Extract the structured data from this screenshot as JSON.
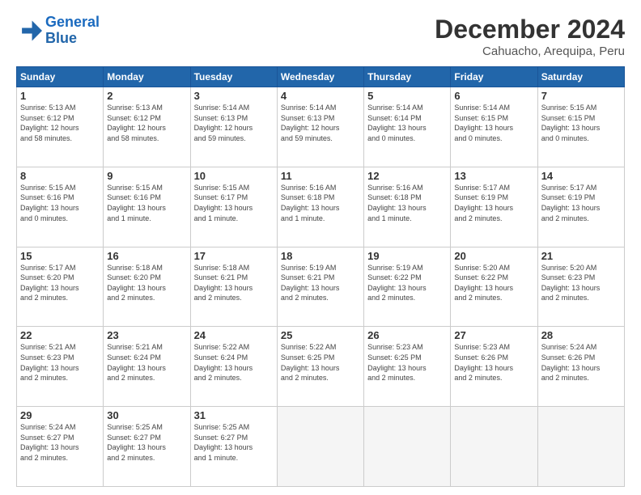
{
  "header": {
    "logo_line1": "General",
    "logo_line2": "Blue",
    "month": "December 2024",
    "location": "Cahuacho, Arequipa, Peru"
  },
  "days_of_week": [
    "Sunday",
    "Monday",
    "Tuesday",
    "Wednesday",
    "Thursday",
    "Friday",
    "Saturday"
  ],
  "weeks": [
    [
      {
        "day": "1",
        "info": "Sunrise: 5:13 AM\nSunset: 6:12 PM\nDaylight: 12 hours\nand 58 minutes."
      },
      {
        "day": "2",
        "info": "Sunrise: 5:13 AM\nSunset: 6:12 PM\nDaylight: 12 hours\nand 58 minutes."
      },
      {
        "day": "3",
        "info": "Sunrise: 5:14 AM\nSunset: 6:13 PM\nDaylight: 12 hours\nand 59 minutes."
      },
      {
        "day": "4",
        "info": "Sunrise: 5:14 AM\nSunset: 6:13 PM\nDaylight: 12 hours\nand 59 minutes."
      },
      {
        "day": "5",
        "info": "Sunrise: 5:14 AM\nSunset: 6:14 PM\nDaylight: 13 hours\nand 0 minutes."
      },
      {
        "day": "6",
        "info": "Sunrise: 5:14 AM\nSunset: 6:15 PM\nDaylight: 13 hours\nand 0 minutes."
      },
      {
        "day": "7",
        "info": "Sunrise: 5:15 AM\nSunset: 6:15 PM\nDaylight: 13 hours\nand 0 minutes."
      }
    ],
    [
      {
        "day": "8",
        "info": "Sunrise: 5:15 AM\nSunset: 6:16 PM\nDaylight: 13 hours\nand 0 minutes."
      },
      {
        "day": "9",
        "info": "Sunrise: 5:15 AM\nSunset: 6:16 PM\nDaylight: 13 hours\nand 1 minute."
      },
      {
        "day": "10",
        "info": "Sunrise: 5:15 AM\nSunset: 6:17 PM\nDaylight: 13 hours\nand 1 minute."
      },
      {
        "day": "11",
        "info": "Sunrise: 5:16 AM\nSunset: 6:18 PM\nDaylight: 13 hours\nand 1 minute."
      },
      {
        "day": "12",
        "info": "Sunrise: 5:16 AM\nSunset: 6:18 PM\nDaylight: 13 hours\nand 1 minute."
      },
      {
        "day": "13",
        "info": "Sunrise: 5:17 AM\nSunset: 6:19 PM\nDaylight: 13 hours\nand 2 minutes."
      },
      {
        "day": "14",
        "info": "Sunrise: 5:17 AM\nSunset: 6:19 PM\nDaylight: 13 hours\nand 2 minutes."
      }
    ],
    [
      {
        "day": "15",
        "info": "Sunrise: 5:17 AM\nSunset: 6:20 PM\nDaylight: 13 hours\nand 2 minutes."
      },
      {
        "day": "16",
        "info": "Sunrise: 5:18 AM\nSunset: 6:20 PM\nDaylight: 13 hours\nand 2 minutes."
      },
      {
        "day": "17",
        "info": "Sunrise: 5:18 AM\nSunset: 6:21 PM\nDaylight: 13 hours\nand 2 minutes."
      },
      {
        "day": "18",
        "info": "Sunrise: 5:19 AM\nSunset: 6:21 PM\nDaylight: 13 hours\nand 2 minutes."
      },
      {
        "day": "19",
        "info": "Sunrise: 5:19 AM\nSunset: 6:22 PM\nDaylight: 13 hours\nand 2 minutes."
      },
      {
        "day": "20",
        "info": "Sunrise: 5:20 AM\nSunset: 6:22 PM\nDaylight: 13 hours\nand 2 minutes."
      },
      {
        "day": "21",
        "info": "Sunrise: 5:20 AM\nSunset: 6:23 PM\nDaylight: 13 hours\nand 2 minutes."
      }
    ],
    [
      {
        "day": "22",
        "info": "Sunrise: 5:21 AM\nSunset: 6:23 PM\nDaylight: 13 hours\nand 2 minutes."
      },
      {
        "day": "23",
        "info": "Sunrise: 5:21 AM\nSunset: 6:24 PM\nDaylight: 13 hours\nand 2 minutes."
      },
      {
        "day": "24",
        "info": "Sunrise: 5:22 AM\nSunset: 6:24 PM\nDaylight: 13 hours\nand 2 minutes."
      },
      {
        "day": "25",
        "info": "Sunrise: 5:22 AM\nSunset: 6:25 PM\nDaylight: 13 hours\nand 2 minutes."
      },
      {
        "day": "26",
        "info": "Sunrise: 5:23 AM\nSunset: 6:25 PM\nDaylight: 13 hours\nand 2 minutes."
      },
      {
        "day": "27",
        "info": "Sunrise: 5:23 AM\nSunset: 6:26 PM\nDaylight: 13 hours\nand 2 minutes."
      },
      {
        "day": "28",
        "info": "Sunrise: 5:24 AM\nSunset: 6:26 PM\nDaylight: 13 hours\nand 2 minutes."
      }
    ],
    [
      {
        "day": "29",
        "info": "Sunrise: 5:24 AM\nSunset: 6:27 PM\nDaylight: 13 hours\nand 2 minutes."
      },
      {
        "day": "30",
        "info": "Sunrise: 5:25 AM\nSunset: 6:27 PM\nDaylight: 13 hours\nand 2 minutes."
      },
      {
        "day": "31",
        "info": "Sunrise: 5:25 AM\nSunset: 6:27 PM\nDaylight: 13 hours\nand 1 minute."
      },
      {
        "day": "",
        "info": ""
      },
      {
        "day": "",
        "info": ""
      },
      {
        "day": "",
        "info": ""
      },
      {
        "day": "",
        "info": ""
      }
    ]
  ]
}
